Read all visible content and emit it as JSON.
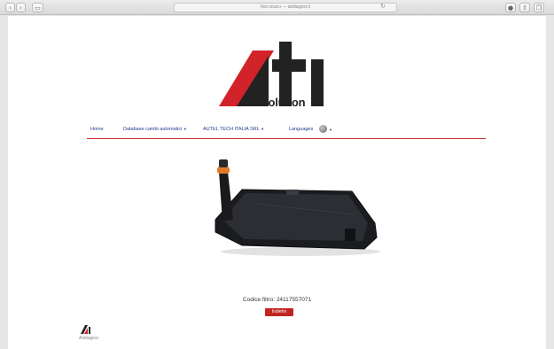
{
  "browser": {
    "address": "fion.issuru — atidiagesr.it",
    "back_icon": "chevron-left-icon",
    "forward_icon": "chevron-right-icon",
    "sidebar_icon": "sidebar-icon",
    "reload_icon": "reload-icon",
    "extension_icon": "extension-icon",
    "share_icon": "share-icon",
    "tabs_icon": "tabs-icon"
  },
  "logo": {
    "brand": "ati",
    "subtitle": "Evolution",
    "colors": {
      "red": "#d2232a",
      "dark": "#222222"
    }
  },
  "nav": {
    "home": "Home",
    "database": "Database cambi automatici",
    "autel": "AUTEL TECH ITALIA SRL",
    "languages": "Languages"
  },
  "product": {
    "code_label": "Codice filtro: 24117557071",
    "back_label": "Indietro"
  },
  "footer": {
    "text": "Atidiagesr"
  },
  "colors": {
    "accent": "#c0251f",
    "nav_link": "#1f3b8c"
  }
}
